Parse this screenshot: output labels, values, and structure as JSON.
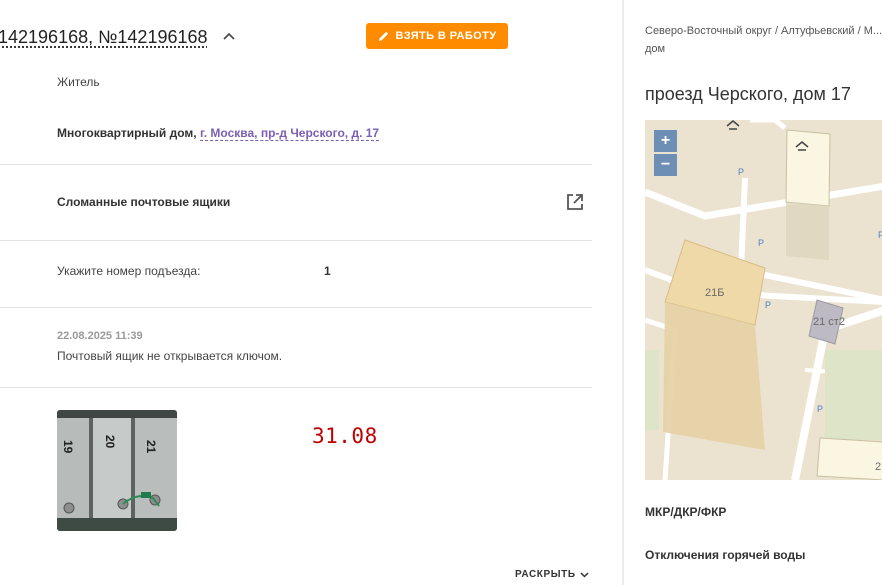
{
  "header": {
    "title": "142196168, №142196168",
    "take_button_label": "ВЗЯТЬ В РАБОТУ"
  },
  "applicant": {
    "type_label": "Житель"
  },
  "address": {
    "building_type": "Многоквартирный дом,",
    "link": "г. Москва, пр-д Черского, д. 17"
  },
  "problem": {
    "category": "Сломанные почтовые ящики"
  },
  "entrance": {
    "question": "Укажите номер подъезда:",
    "answer": "1"
  },
  "message": {
    "date": "22.08.2025 11:39",
    "text": "Почтовый ящик не открывается ключом."
  },
  "deadline": "31.08",
  "expand_label": "РАСКРЫТЬ",
  "photo": {
    "box_numbers": [
      "19",
      "20",
      "21"
    ]
  },
  "right_panel": {
    "breadcrumbs": "Северо-Восточный округ / Алтуфьевский / М... дом",
    "address_title": "проезд Черского, дом 17",
    "map": {
      "zoom_in": "+",
      "zoom_out": "−",
      "building_labels": [
        "21Б",
        "21 ст2",
        "2"
      ],
      "parking_symbol": "P"
    },
    "sections": [
      "МКР/ДКР/ФКР",
      "Отключения горячей воды"
    ]
  },
  "colors": {
    "accent_orange": "#ff8c00",
    "link_purple": "#7a5fb5",
    "deadline_red": "#c00000",
    "zoom_blue": "#6e8fb5"
  }
}
